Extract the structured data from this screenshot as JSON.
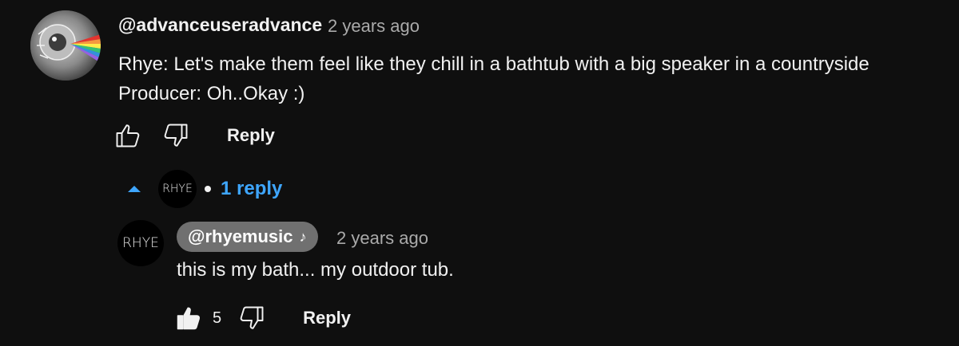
{
  "comment": {
    "avatar_icon": "moon-eye-avatar",
    "handle": "@advanceuseradvance",
    "time": "2 years ago",
    "text": "Rhye: Let's make them feel like they chill in a bathtub with a big speaker in a countryside\nProducer: Oh..Okay :)",
    "actions": {
      "like_icon": "thumbs-up-outline-icon",
      "dislike_icon": "thumbs-down-outline-icon",
      "reply_label": "Reply"
    }
  },
  "replies_toggle": {
    "caret_icon": "caret-up-icon",
    "avatar_text": "RHYE",
    "label": "1 reply",
    "accent": "#3ea6ff"
  },
  "reply": {
    "avatar_text": "RHYE",
    "handle": "@rhyemusic",
    "verified_icon": "music-note-icon",
    "note_glyph": "♪",
    "time": "2 years ago",
    "text": "this is my bath... my outdoor tub.",
    "actions": {
      "like_icon": "thumbs-up-filled-icon",
      "like_count": "5",
      "dislike_icon": "thumbs-down-outline-icon",
      "reply_label": "Reply"
    }
  }
}
